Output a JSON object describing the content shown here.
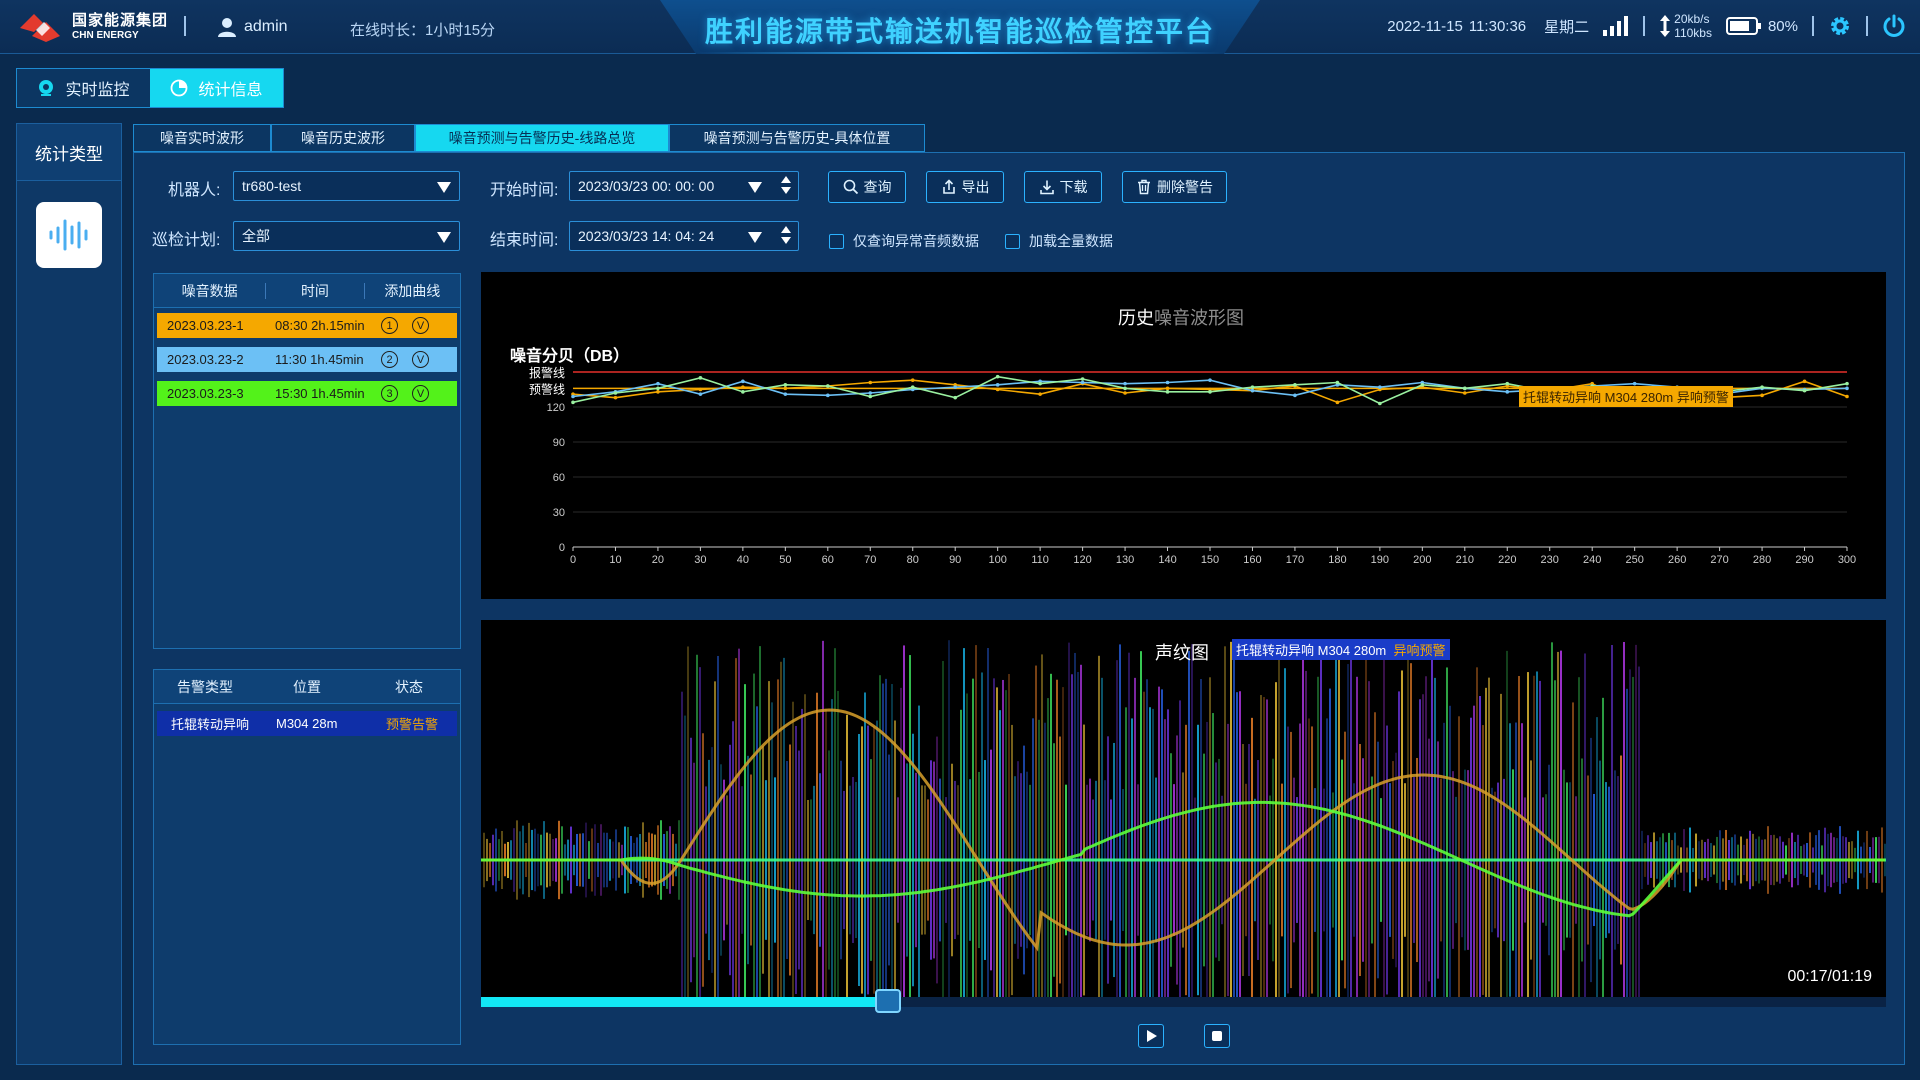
{
  "header": {
    "logo_cn": "国家能源集团",
    "logo_en": "CHN ENERGY",
    "username": "admin",
    "online_label": "在线时长：",
    "online_value": "1小时15分",
    "title": "胜利能源带式输送机智能巡检管控平台",
    "date": "2022-11-15",
    "time": "11:30:36",
    "weekday": "星期二",
    "up_speed": "20kb/s",
    "down_speed": "110kbs",
    "battery": "80%",
    "icons": [
      "user-icon",
      "signal-icon",
      "updown-arrow-icon",
      "battery-icon",
      "gear-icon",
      "power-icon"
    ]
  },
  "mode_tabs": [
    {
      "label": "实时监控",
      "icon": "camera-icon",
      "active": false
    },
    {
      "label": "统计信息",
      "icon": "pie-chart-icon",
      "active": true
    }
  ],
  "rail": {
    "title": "统计类型",
    "button_icon": "sound-wave-icon"
  },
  "subtabs": [
    {
      "label": "噪音实时波形",
      "active": false
    },
    {
      "label": "噪音历史波形",
      "active": false
    },
    {
      "label": "噪音预测与告警历史-线路总览",
      "active": true
    },
    {
      "label": "噪音预测与告警历史-具体位置",
      "active": false
    }
  ],
  "filters": {
    "robot_label": "机器人:",
    "robot_value": "tr680-test",
    "plan_label": "巡检计划:",
    "plan_value": "全部",
    "start_label": "开始时间:",
    "start_value": "2023/03/23 00: 00: 00",
    "end_label": "结束时间:",
    "end_value": "2023/03/23 14: 04: 24",
    "btn_query": "查询",
    "btn_export": "导出",
    "btn_download": "下载",
    "btn_delete": "删除警告",
    "chk_abnormal": "仅查询异常音频数据",
    "chk_full": "加载全量数据"
  },
  "noise_table": {
    "headers": [
      "噪音数据",
      "时间",
      "添加曲线"
    ],
    "rows": [
      {
        "date": "2023.03.23-1",
        "time": "08:30 2h.15min",
        "num": "1",
        "v": "V",
        "color": "#f5a800"
      },
      {
        "date": "2023.03.23-2",
        "time": "11:30 1h.45min",
        "num": "2",
        "v": "V",
        "color": "#6cc0f5"
      },
      {
        "date": "2023.03.23-3",
        "time": "15:30 1h.45min",
        "num": "3",
        "v": "V",
        "color": "#53f21a"
      }
    ]
  },
  "alarm_table": {
    "headers": [
      "告警类型",
      "位置",
      "状态"
    ],
    "row": {
      "type": "托辊转动异响",
      "position": "M304 28m",
      "status": "预警告警",
      "status_color": "#f5a800"
    }
  },
  "history_chart": {
    "title_a": "历史",
    "title_b": "噪音波形图",
    "ylabel": "噪音分贝（DB）",
    "alarm_line_label": "报警线",
    "warn_line_label": "预警线",
    "tag": "托辊转动异响   M304 280m   异响预警"
  },
  "chart_data": {
    "type": "line",
    "x": [
      0,
      10,
      20,
      30,
      40,
      50,
      60,
      70,
      80,
      90,
      100,
      110,
      120,
      130,
      140,
      150,
      160,
      170,
      180,
      190,
      200,
      210,
      220,
      230,
      240,
      250,
      260,
      270,
      280,
      290,
      300
    ],
    "x_ticks": [
      0,
      10,
      20,
      30,
      40,
      50,
      60,
      70,
      80,
      90,
      100,
      110,
      120,
      130,
      140,
      150,
      160,
      170,
      180,
      190,
      200,
      210,
      220,
      230,
      240,
      250,
      260,
      270,
      280,
      290,
      300
    ],
    "y_ticks": [
      0,
      30,
      60,
      90,
      120
    ],
    "ylim": [
      0,
      150
    ],
    "ylabel": "噪音分贝（DB）",
    "alarm_line": 150,
    "warn_line": 136,
    "series": [
      {
        "color": "#f5a800",
        "values": [
          131,
          128,
          133,
          135,
          137,
          136,
          138,
          141,
          143,
          139,
          135,
          131,
          140,
          132,
          136,
          135,
          134,
          138,
          124,
          135,
          137,
          132,
          138,
          134,
          140,
          123,
          125,
          128,
          130,
          142,
          129
        ]
      },
      {
        "color": "#6cc0f5",
        "values": [
          129,
          133,
          140,
          131,
          142,
          131,
          130,
          132,
          135,
          137,
          139,
          142,
          141,
          140,
          141,
          143,
          134,
          130,
          139,
          137,
          141,
          136,
          133,
          135,
          138,
          140,
          137,
          131,
          136,
          135,
          136
        ]
      },
      {
        "color": "#9af0a0",
        "values": [
          124,
          132,
          136,
          145,
          133,
          139,
          138,
          129,
          137,
          128,
          146,
          140,
          144,
          136,
          133,
          133,
          137,
          139,
          141,
          123,
          139,
          136,
          140,
          133,
          138,
          135,
          131,
          133,
          137,
          134,
          140
        ]
      }
    ]
  },
  "spectro": {
    "title": "声纹图",
    "tag_main": "托辊转动异响   M304 280m",
    "tag_status": "异响预警",
    "time": "00:17/01:19",
    "progress": 0.29
  },
  "player_icons": [
    "play-icon",
    "stop-icon"
  ]
}
